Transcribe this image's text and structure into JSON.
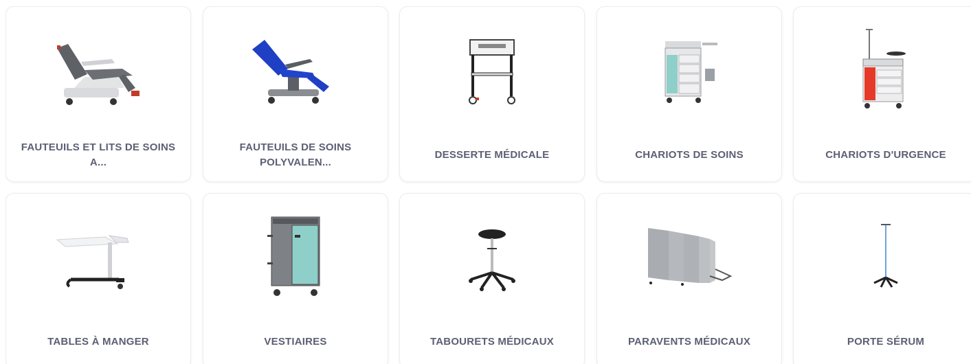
{
  "products": [
    {
      "label": "FAUTEUILS ET LITS DE SOINS A...",
      "icon": "medical-recliner-image"
    },
    {
      "label": "FAUTEUILS DE SOINS POLYVALEN...",
      "icon": "care-chair-image"
    },
    {
      "label": "DESSERTE MÉDICALE",
      "icon": "medical-cart-image"
    },
    {
      "label": "CHARIOTS DE SOINS",
      "icon": "care-trolley-image"
    },
    {
      "label": "CHARIOTS D'URGENCE",
      "icon": "emergency-trolley-image"
    },
    {
      "label": "TABLES À MANGER",
      "icon": "overbed-table-image"
    },
    {
      "label": "VESTIAIRES",
      "icon": "locker-image"
    },
    {
      "label": "TABOURETS MÉDICAUX",
      "icon": "medical-stool-image"
    },
    {
      "label": "PARAVENTS MÉDICAUX",
      "icon": "medical-screen-image"
    },
    {
      "label": "PORTE SÉRUM",
      "icon": "iv-pole-image"
    }
  ],
  "colors": {
    "label": "#5b5f73",
    "card_border": "#ececef",
    "chair_blue": "#1f3fc4",
    "teal_panel": "#8fcfc9",
    "emergency_red": "#e53a2a"
  }
}
